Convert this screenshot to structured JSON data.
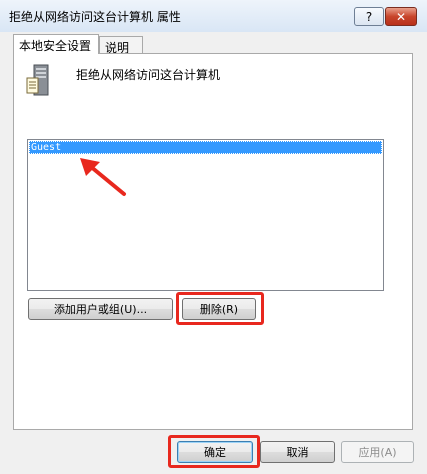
{
  "window": {
    "title": "拒绝从网络访问这台计算机 属性",
    "help_label": "?",
    "close_label": "✕"
  },
  "tabs": [
    {
      "label": "本地安全设置",
      "active": true
    },
    {
      "label": "说明",
      "active": false
    }
  ],
  "policy": {
    "icon": "server-policy-icon",
    "title": "拒绝从网络访问这台计算机"
  },
  "list": {
    "items": [
      "Guest"
    ],
    "selected_index": 0
  },
  "actions": {
    "add_label": "添加用户或组(U)...",
    "remove_label": "删除(R)"
  },
  "footer": {
    "ok_label": "确定",
    "cancel_label": "取消",
    "apply_label": "应用(A)"
  },
  "colors": {
    "selection": "#3399ff",
    "annotation": "#e8281e"
  }
}
